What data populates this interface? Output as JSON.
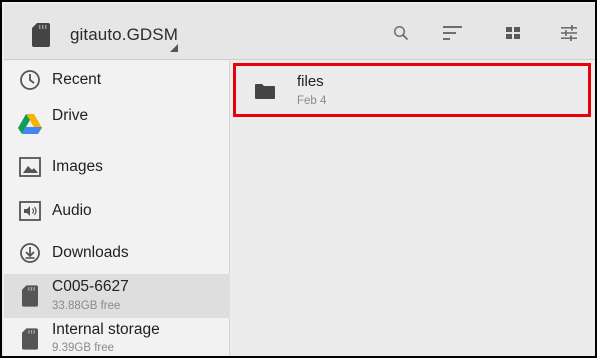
{
  "toolbar": {
    "root_title": "gitauto.GDSM",
    "icons": [
      "search-icon",
      "sort-icon",
      "grid-view-icon",
      "settings-sliders-icon"
    ]
  },
  "sidebar": {
    "items": [
      {
        "label": "Recent",
        "icon": "clock-icon"
      },
      {
        "label": "Drive",
        "icon": "drive-icon"
      },
      {
        "label": "Images",
        "icon": "image-icon"
      },
      {
        "label": "Audio",
        "icon": "audio-icon"
      },
      {
        "label": "Downloads",
        "icon": "download-icon"
      },
      {
        "label": "C005-6627",
        "sub": "33.88GB free",
        "icon": "sd-card-icon",
        "selected": true
      },
      {
        "label": "Internal storage",
        "sub": "9.39GB free",
        "icon": "sd-card-icon"
      }
    ]
  },
  "main": {
    "files": [
      {
        "name": "files",
        "date": "Feb 4",
        "icon": "folder-icon"
      }
    ]
  },
  "colors": {
    "highlight_border": "#e8000b",
    "selected_bg": "#dedede"
  }
}
